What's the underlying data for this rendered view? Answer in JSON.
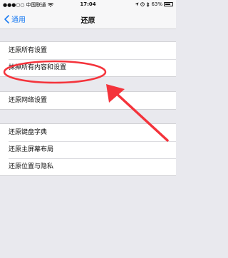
{
  "status_bar": {
    "signal": "●●●○○",
    "carrier": "中国联通",
    "wifi": "wifi-icon",
    "time": "17:04",
    "alarm": "alarm-icon",
    "bluetooth": "bluetooth-icon",
    "battery_percent": "63%"
  },
  "nav": {
    "back_label": "通用",
    "title": "还原"
  },
  "groups": [
    {
      "items": [
        "还原所有设置",
        "抹掉所有内容和设置"
      ]
    },
    {
      "items": [
        "还原网络设置"
      ]
    },
    {
      "items": [
        "还原键盘字典",
        "还原主屏幕布局",
        "还原位置与隐私"
      ]
    }
  ],
  "annotation": {
    "color": "#f4333b",
    "shape": "ellipse-with-arrow",
    "target": "抹掉所有内容和设置"
  }
}
